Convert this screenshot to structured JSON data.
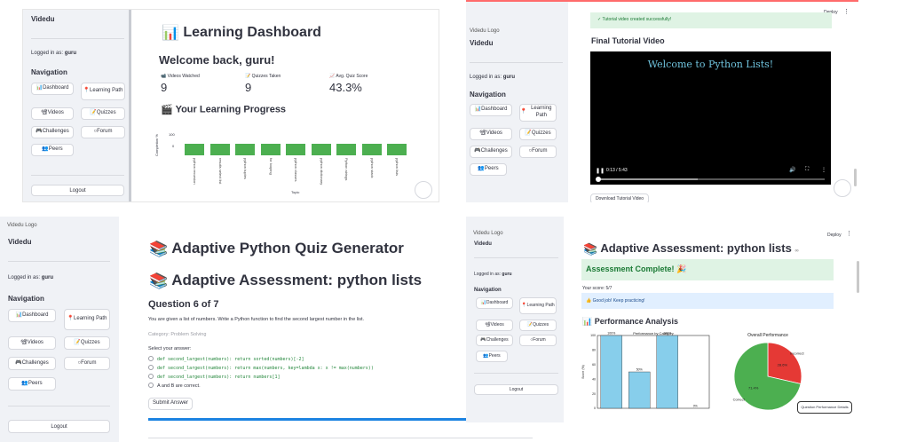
{
  "app": {
    "brand": "Videdu",
    "logo_alt": "Videdu Logo",
    "logged_in_prefix": "Logged in as:",
    "user": "guru",
    "nav_title": "Navigation",
    "logout": "Logout",
    "deploy": "Deploy"
  },
  "nav": {
    "dashboard": "Dashboard",
    "learning_path": "Learning Path",
    "videos": "Videos",
    "quizzes": "Quizzes",
    "challenges": "Challenges",
    "forum": "Forum",
    "peers": "Peers"
  },
  "dashboard": {
    "title": "Learning Dashboard",
    "welcome": "Welcome back, guru!",
    "metrics": [
      {
        "label": "Videos Watched",
        "value": "9"
      },
      {
        "label": "Quizzes Taken",
        "value": "9"
      },
      {
        "label": "Avg. Quiz Score",
        "value": "43.3%"
      }
    ],
    "progress_title": "Your Learning Progress",
    "ylabel": "Completion %",
    "xlabel": "Topic",
    "yticks": [
      "100",
      "0"
    ]
  },
  "chart_data": [
    {
      "type": "bar",
      "categories": [
        "python recursion",
        "results select list",
        "python tuples",
        "for looping",
        "python classes",
        "python dictionary",
        "Python strings",
        "python stack",
        "python lists"
      ],
      "values": [
        100,
        100,
        100,
        100,
        100,
        100,
        100,
        100,
        100
      ],
      "xlabel": "Topic",
      "ylabel": "Completion %",
      "ylim": [
        0,
        100
      ]
    },
    {
      "type": "bar",
      "title": "Performance by Category",
      "ylabel": "Score (%)",
      "categories": [
        "",
        "",
        "",
        ""
      ],
      "values": [
        100,
        50,
        100,
        0
      ],
      "data_labels": [
        "100%",
        "50%",
        "100%",
        "0%"
      ],
      "ylim": [
        0,
        100
      ]
    },
    {
      "type": "pie",
      "title": "Overall Performance",
      "labels": [
        "Incorrect",
        "Correct"
      ],
      "values": [
        28.6,
        71.4
      ],
      "data_labels": [
        "28.6%",
        "71.4%"
      ],
      "colors": [
        "#e53935",
        "#4caf50"
      ]
    }
  ],
  "video": {
    "top_status": "Tutorial video created successfully!",
    "heading": "Final Tutorial Video",
    "frame_text": "Welcome to Python Lists!",
    "time": "0:13 / 5:43",
    "download": "Download Tutorial Video"
  },
  "quiz": {
    "generator_title": "Adaptive Python Quiz Generator",
    "assessment_title": "Adaptive Assessment: python lists",
    "question_heading": "Question 6 of 7",
    "question": "You are given a list of numbers. Write a Python function to find the second largest number in the list.",
    "category": "Category: Problem Solving",
    "select_prompt": "Select your answer:",
    "options": [
      "def second_largest(numbers): return sorted(numbers)[-2]",
      "def second_largest(numbers): return max(numbers, key=lambda x: x != max(numbers))",
      "def second_largest(numbers): return numbers[1]",
      "A and B are correct."
    ],
    "submit": "Submit Answer"
  },
  "results": {
    "title": "Adaptive Assessment: python lists",
    "complete": "Assessment Complete!",
    "score": "Your score: 5/7",
    "feedback": "Good job! Keep practicing!",
    "analysis_title": "Performance Analysis",
    "pie_overlay_btn": "Question Performance Details"
  },
  "colors": {
    "green": "#4caf50",
    "red": "#e53935",
    "sky": "#87ceeb",
    "sidebar": "#f0f2f6",
    "progress_blue": "#1c83e1"
  }
}
